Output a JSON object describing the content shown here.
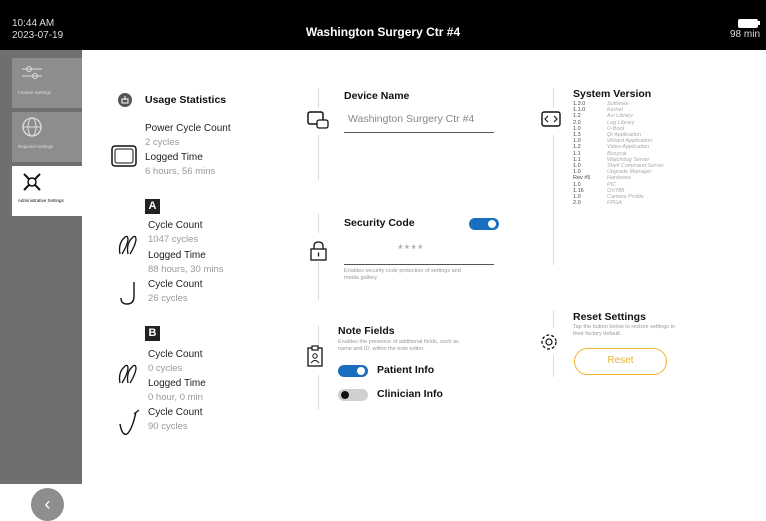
{
  "status_bar": {
    "time": "10:44 AM",
    "date": "2023-07-19",
    "title": "Washington Surgery Ctr #4",
    "battery": "98 min"
  },
  "sidebar": {
    "items": [
      {
        "label": "Feature Settings",
        "icon": "sliders-icon"
      },
      {
        "label": "Regional Settings",
        "icon": "globe-icon"
      },
      {
        "label": "Administrative Settings",
        "icon": "tools-icon"
      }
    ],
    "back_icon": "chevron-left-icon"
  },
  "usage": {
    "title": "Usage Statistics",
    "console": {
      "cycle_label": "Power Cycle Count",
      "cycle_value": "2 cycles",
      "time_label": "Logged Time",
      "time_value": "6 hours, 56 mins"
    },
    "a": {
      "badge": "A",
      "cycle_label": "Cycle Count",
      "cycle_value": "1047 cycles",
      "time_label": "Logged Time",
      "time_value": "88 hours, 30 mins",
      "cycle2_label": "Cycle Count",
      "cycle2_value": "26 cycles"
    },
    "b": {
      "badge": "B",
      "cycle_label": "Cycle Count",
      "cycle_value": "0 cycles",
      "time_label": "Logged Time",
      "time_value": "0 hour, 0 min",
      "cycle2_label": "Cycle Count",
      "cycle2_value": "90 cycles"
    }
  },
  "device": {
    "title": "Device Name",
    "value": "Washington Surgery Ctr #4"
  },
  "security": {
    "title": "Security Code",
    "value": "****",
    "enabled": true,
    "hint": "Enables security code protection of settings and media gallery."
  },
  "notes": {
    "title": "Note Fields",
    "hint": "Enables the presence of additional fields, such as name and ID, within the note editor.",
    "patient": {
      "label": "Patient Info",
      "on": true
    },
    "clinician": {
      "label": "Clinician Info",
      "on": false
    }
  },
  "system": {
    "title": "System Version",
    "rows": [
      {
        "v": "1.3.0",
        "n": "Software"
      },
      {
        "v": "1.1.0",
        "n": "Kernel"
      },
      {
        "v": "1.2",
        "n": "Avi Library"
      },
      {
        "v": "2.0",
        "n": "Log Library"
      },
      {
        "v": "1.0",
        "n": "U-Boot"
      },
      {
        "v": "1.3",
        "n": "Qt Application"
      },
      {
        "v": "1.0",
        "n": "Wizard Application"
      },
      {
        "v": "1.2",
        "n": "Video Application"
      },
      {
        "v": "1.1",
        "n": "Busycat"
      },
      {
        "v": "1.1",
        "n": "Watchdog Server"
      },
      {
        "v": "1.0",
        "n": "Shell Command Server"
      },
      {
        "v": "1.0",
        "n": "Upgrade Manager"
      },
      {
        "v": "Rev #5",
        "n": "Hardware"
      },
      {
        "v": "1.0",
        "n": "PIC"
      },
      {
        "v": "1.16",
        "n": "OV788"
      },
      {
        "v": "1.0",
        "n": "Camera Profile"
      },
      {
        "v": "2.0",
        "n": "FPGA"
      }
    ]
  },
  "reset": {
    "title": "Reset Settings",
    "hint": "Tap the button below to restore settings to their factory default.",
    "button": "Reset"
  },
  "colors": {
    "accent": "#1a6ec0",
    "reset": "#f0b429",
    "sidebar": "#6f6f6f"
  }
}
